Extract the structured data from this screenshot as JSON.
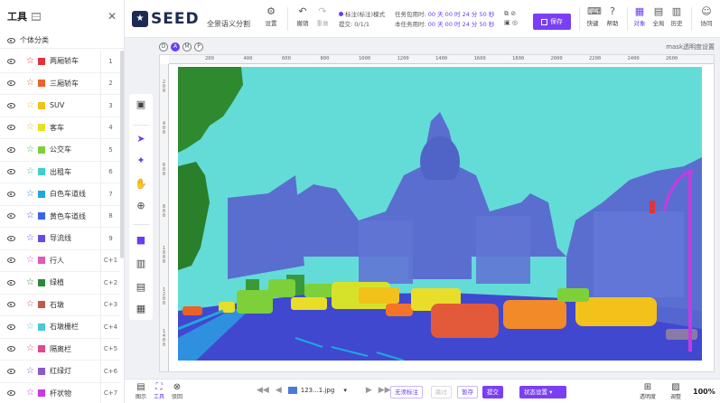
{
  "left_panel": {
    "title": "工具",
    "section": "个体分类",
    "classes": [
      {
        "name": "两厢轿车",
        "key": "1",
        "color": "#e0343a",
        "star": "#e0343a"
      },
      {
        "name": "三厢轿车",
        "key": "2",
        "color": "#e8632a",
        "star": "#e8632a"
      },
      {
        "name": "SUV",
        "key": "3",
        "color": "#f2c11a",
        "star": "#f2c11a"
      },
      {
        "name": "客车",
        "key": "4",
        "color": "#e8de2a",
        "star": "#e8b12a"
      },
      {
        "name": "公交车",
        "key": "5",
        "color": "#7dd03a",
        "star": "#3ab24a"
      },
      {
        "name": "出租车",
        "key": "6",
        "color": "#3fd0c8",
        "star": "#3ab2a0"
      },
      {
        "name": "白色车道线",
        "key": "7",
        "color": "#1ea8e0",
        "star": "#1e88e0"
      },
      {
        "name": "黄色车道线",
        "key": "8",
        "color": "#3a64e8",
        "star": "#3a4ae8"
      },
      {
        "name": "导流线",
        "key": "9",
        "color": "#6a4ae8",
        "star": "#6a4ae8"
      },
      {
        "name": "行人",
        "key": "C+1",
        "color": "#e05ab8",
        "star": "#e05ab8"
      },
      {
        "name": "绿植",
        "key": "C+2",
        "color": "#2a8a3a",
        "star": "#2a8a3a"
      },
      {
        "name": "石墩",
        "key": "C+3",
        "color": "#c05a4a",
        "star": "#c05a4a"
      },
      {
        "name": "石墩栅栏",
        "key": "C+4",
        "color": "#4ac8d8",
        "star": "#4ac8d8"
      },
      {
        "name": "隔离栏",
        "key": "C+5",
        "color": "#e04a8a",
        "star": "#e04a8a"
      },
      {
        "name": "红绿灯",
        "key": "C+6",
        "color": "#8a5ac8",
        "star": "#8a5ac8"
      },
      {
        "name": "杆状物",
        "key": "C+7",
        "color": "#c83ae0",
        "star": "#c83ae0"
      }
    ]
  },
  "topbar": {
    "logo_text": "SEED",
    "mode": "全景语义分割",
    "settings": "设置",
    "undo": "撤销",
    "redo": "重做",
    "status_line": "标注(标注)模式",
    "submit_line": "提交: 0/1/1",
    "timer1_label": "任务包用时:",
    "timer1_value": "00 天 00 时 24 分 50 秒",
    "timer2_label": "本任务用时:",
    "timer2_value": "00 天 00 时 24 分 50 秒",
    "save": "保存",
    "shortcut": "快键",
    "help": "帮助",
    "object": "对象",
    "global": "全局",
    "history": "历史",
    "collab": "协同"
  },
  "canvas": {
    "modes": [
      "D",
      "A",
      "M",
      "P"
    ],
    "mask_opacity": "mask透明度设置",
    "ruler_h": [
      "200",
      "400",
      "600",
      "800",
      "1000",
      "1200",
      "1400",
      "1600",
      "1800",
      "2000",
      "2200",
      "2400",
      "2600"
    ],
    "ruler_v": [
      "200",
      "400",
      "600",
      "800",
      "1000",
      "1200",
      "1400"
    ]
  },
  "bottombar": {
    "list_label": "图示",
    "tool_label": "工具",
    "review_label": "驳回",
    "filename": "123...1.jpg",
    "no_label": "无须标注",
    "prev_label": "跳过",
    "save_btn": "暂存",
    "submit_btn": "提交",
    "status_btn": "状态设置",
    "opacity_label": "透明度",
    "adjust_label": "调整",
    "zoom": "100%"
  },
  "colors": {
    "accent": "#7a3ff5",
    "sky": "#63dcd7",
    "building": "#5a6ed0",
    "road": "#4048d0"
  }
}
